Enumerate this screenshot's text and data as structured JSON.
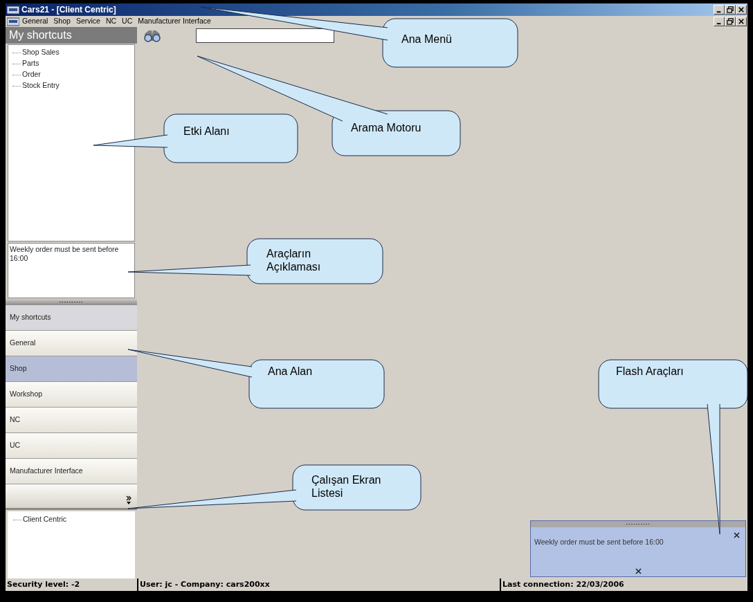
{
  "window": {
    "title": "Cars21 - [Client Centric]"
  },
  "menu": [
    "General",
    "Shop",
    "Service",
    "NC",
    "UC",
    "Manufacturer Interface"
  ],
  "shortcuts_panel": {
    "title": "My shortcuts",
    "items": [
      "Shop Sales",
      "Parts",
      "Order",
      "Stock Entry"
    ],
    "description": "Weekly order must be sent before 16:00"
  },
  "nav_sections": [
    {
      "label": "My shortcuts",
      "selected": false,
      "expanded": true
    },
    {
      "label": "General",
      "selected": false,
      "expanded": false
    },
    {
      "label": "Shop",
      "selected": true,
      "expanded": false
    },
    {
      "label": "Workshop",
      "selected": false,
      "expanded": false
    },
    {
      "label": "NC",
      "selected": false,
      "expanded": false
    },
    {
      "label": "UC",
      "selected": false,
      "expanded": false
    },
    {
      "label": "Manufacturer Interface",
      "selected": false,
      "expanded": false
    }
  ],
  "open_screens": [
    "Client Centric"
  ],
  "status_bar": [
    "Security level: -2",
    "User: jc - Company: cars200xx",
    "Last connection: 22/03/2006"
  ],
  "flash_panel": {
    "message": "Weekly order must be sent before 16:00"
  },
  "callouts": [
    "Ana Menü",
    "Arama Motoru",
    "Etki Alanı",
    "Araçların Açıklaması",
    "Ana Alan",
    "Çalışan Ekran Listesi",
    "Flash Araçları"
  ]
}
